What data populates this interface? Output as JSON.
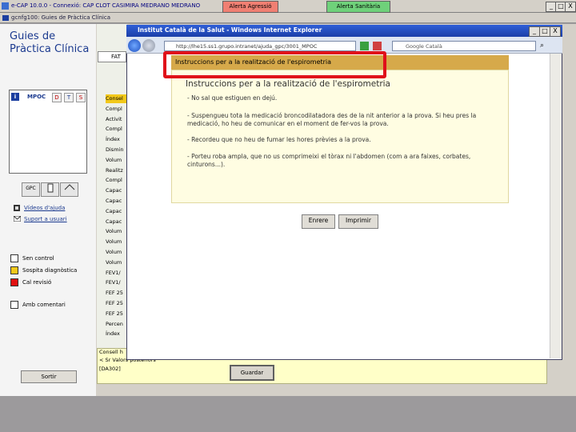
{
  "app": {
    "title": "e-CAP 10.0.0 - Connexió: CAP CLOT CASIMIRA MEDRANO MEDRANO",
    "btn_agressio": "Alerta Agressió",
    "btn_sanitaria": "Alerta Sanitària",
    "subwindow_title": "gcnfg100: Guies de Pràctica Clínica",
    "min": "_",
    "max": "□",
    "close": "X"
  },
  "sidebar": {
    "app_name": "Guies de Pràctica Clínica",
    "list_tag": "MPOC",
    "list_info": "i",
    "tab_d": "D",
    "tab_t": "T",
    "tab_s": "S",
    "btn_gpc": "GPC",
    "videos": "Vídeos d'ajuda",
    "suport": "Suport a usuari",
    "legend": [
      {
        "label": "Sen control",
        "color": "#ffffff"
      },
      {
        "label": "Sospita diagnòstica",
        "color": "#f2c81a"
      },
      {
        "label": "Cal revisió",
        "color": "#e01010"
      },
      {
        "label": "Amb comentari",
        "color": "#ffffff"
      }
    ],
    "sortir": "Sortir"
  },
  "form": {
    "tab_label": "FAT",
    "rows": [
      "Consel",
      "Compl",
      "Activit",
      "Compl",
      "Índex",
      "Dismin",
      "Volum",
      "Realitz",
      "Compl",
      "Capac",
      "Capac",
      "Capac",
      "Capac",
      "Volum",
      "Volum",
      "Volum",
      "Volum",
      "FEV1/",
      "FEV1/",
      "FEF 25",
      "FEF 25",
      "FEF 25",
      "Percen",
      "Índex"
    ],
    "bottom_text_1": "Consell h",
    "bottom_text_2": "< Sr Valors posteriors",
    "bottom_text_3": "[DA302]",
    "guardar": "Guardar"
  },
  "ie": {
    "title": "Institut Català de la Salut - Windows Internet Explorer",
    "address": "http://lhe15.ss1.grupo.intranet/ajuda_gpc/3001_MPOC",
    "search": "Google Català",
    "doc_header": "Instruccions per a la realització de l'espirometria",
    "doc_title": "Instruccions per a la realització de l'espirometria",
    "paragraphs": [
      "- No sal que estiguen en dejú.",
      "- Suspengueu tota la medicació broncodilatadora des de la nit anterior a la prova. Si heu pres la medicació, ho heu de comunicar en el moment de fer-vos la prova.",
      "- Recordeu que no heu de fumar les hores prèvies a la prova.",
      "- Porteu roba ampla, que no us comprimeixi el tòrax ni l'abdomen (com a ara faixes, corbates, cinturons...)."
    ],
    "btn_enrere": "Enrere",
    "btn_imprimir": "Imprimir"
  },
  "colors": {
    "highlight": "#e0101a",
    "doc_header": "#d6a94a",
    "doc_body": "#fffde2"
  }
}
